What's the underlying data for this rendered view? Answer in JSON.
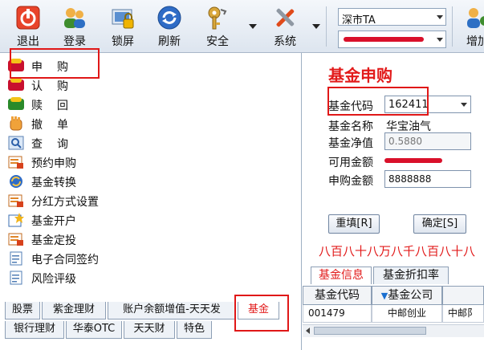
{
  "toolbar": {
    "buttons": [
      {
        "label": "退出",
        "icon": "power-icon"
      },
      {
        "label": "登录",
        "icon": "users-icon"
      },
      {
        "label": "锁屏",
        "icon": "lock-screen-icon"
      },
      {
        "label": "刷新",
        "icon": "refresh-icon"
      },
      {
        "label": "安全",
        "icon": "key-icon"
      },
      {
        "label": "系统",
        "icon": "tools-icon"
      },
      {
        "label": "增加",
        "icon": "add-icon"
      }
    ],
    "market_select": "深市TA",
    "account_select": "[redacted]"
  },
  "menu": [
    {
      "label": "申购",
      "icon": "buy-icon"
    },
    {
      "label": "认购",
      "icon": "buy-icon"
    },
    {
      "label": "赎回",
      "icon": "sell-icon"
    },
    {
      "label": "撤单",
      "icon": "cancel-hand-icon"
    },
    {
      "label": "查询",
      "icon": "search-icon"
    },
    {
      "label": "预约申购",
      "icon": "form-icon"
    },
    {
      "label": "基金转换",
      "icon": "convert-icon"
    },
    {
      "label": "分红方式设置",
      "icon": "form-icon"
    },
    {
      "label": "基金开户",
      "icon": "open-account-icon"
    },
    {
      "label": "基金定投",
      "icon": "form-icon"
    },
    {
      "label": "电子合同签约",
      "icon": "document-icon"
    },
    {
      "label": "风险评级",
      "icon": "document-icon"
    }
  ],
  "bottom_tabs_row1": [
    "股票",
    "紫金理财",
    "账户余额增值-天天发",
    "基金"
  ],
  "bottom_tabs_row2": [
    "银行理财",
    "华泰OTC",
    "天天财",
    "特色"
  ],
  "form": {
    "title": "基金申购",
    "code_label": "基金代码",
    "code_value": "162411",
    "name_label": "基金名称",
    "name_value": "华宝油气",
    "nav_label": "基金净值",
    "nav_value": "0.5880",
    "avail_label": "可用金额",
    "avail_value": "[redacted]",
    "amount_label": "申购金额",
    "amount_value": "8888888",
    "reset_button": "重填[R]",
    "confirm_button": "确定[S]",
    "amount_chinese": "八百八十八万八千八百八十八"
  },
  "info_tabs": [
    "基金信息",
    "基金折扣率"
  ],
  "grid": {
    "headers": [
      "基金代码",
      "基金公司",
      ""
    ],
    "rows": [
      [
        "001479",
        "中邮创业",
        "中邮阝"
      ]
    ]
  },
  "colors": {
    "accent_red": "#e21a1a",
    "highlight_red": "#e01818"
  }
}
